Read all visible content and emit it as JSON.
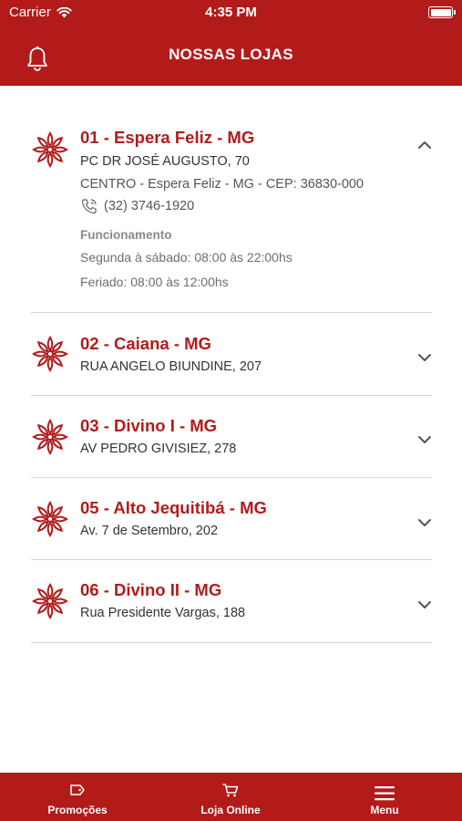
{
  "status_bar": {
    "carrier": "Carrier",
    "time": "4:35 PM"
  },
  "header": {
    "title": "NOSSAS LOJAS"
  },
  "stores": [
    {
      "name": "01 - Espera Feliz - MG",
      "address": "PC DR JOSÉ AUGUSTO, 70",
      "district": "CENTRO - Espera Feliz - MG - CEP: 36830-000",
      "phone": "(32) 3746-1920",
      "hours_title": "Funcionamento",
      "hours_weekday": "Segunda à sábado: 08:00 às 22:00hs",
      "hours_holiday": "Feriado: 08:00 às 12:00hs",
      "expanded": true
    },
    {
      "name": "02 - Caiana - MG",
      "address": "RUA ANGELO BIUNDINE, 207",
      "expanded": false
    },
    {
      "name": "03 - Divino I - MG",
      "address": "AV PEDRO GIVISIEZ, 278",
      "expanded": false
    },
    {
      "name": "05 - Alto Jequitibá - MG",
      "address": "Av. 7 de Setembro, 202",
      "expanded": false
    },
    {
      "name": "06 - Divino II - MG",
      "address": "Rua Presidente Vargas, 188",
      "expanded": false
    }
  ],
  "tabbar": {
    "promocoes": "Promoções",
    "loja_online": "Loja Online",
    "menu": "Menu"
  },
  "colors": {
    "brand": "#b31b1b",
    "divider": "#d4d4d4"
  },
  "icons": [
    "wifi-icon",
    "battery-icon",
    "bell-icon",
    "flower-icon",
    "chevron-up-icon",
    "chevron-down-icon",
    "phone-icon",
    "tag-icon",
    "cart-icon",
    "hamburger-icon"
  ]
}
